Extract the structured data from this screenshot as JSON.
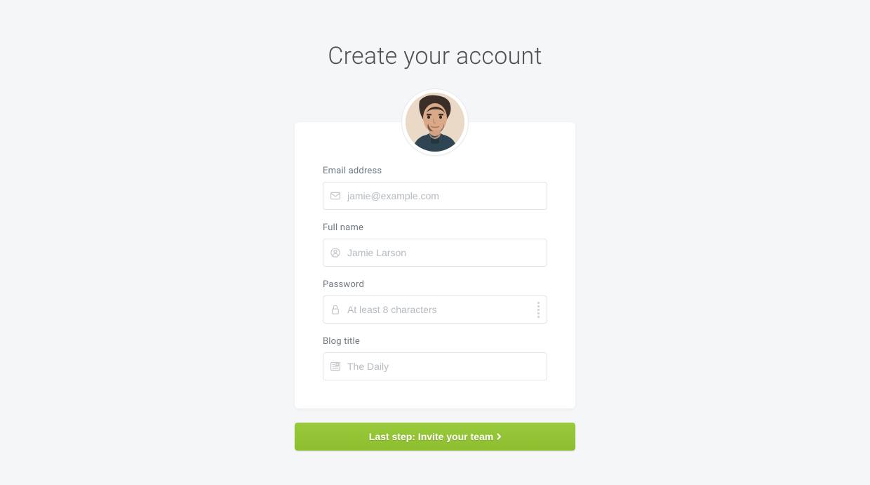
{
  "title": "Create your account",
  "fields": {
    "email": {
      "label": "Email address",
      "placeholder": "jamie@example.com",
      "value": ""
    },
    "name": {
      "label": "Full name",
      "placeholder": "Jamie Larson",
      "value": ""
    },
    "password": {
      "label": "Password",
      "placeholder": "At least 8 characters",
      "value": ""
    },
    "blog": {
      "label": "Blog title",
      "placeholder": "The Daily",
      "value": ""
    }
  },
  "submit_label": "Last step: Invite your team",
  "colors": {
    "accent": "#8fc33a",
    "background": "#f5f6f7",
    "text": "#4d5154",
    "muted": "#6f7880"
  }
}
